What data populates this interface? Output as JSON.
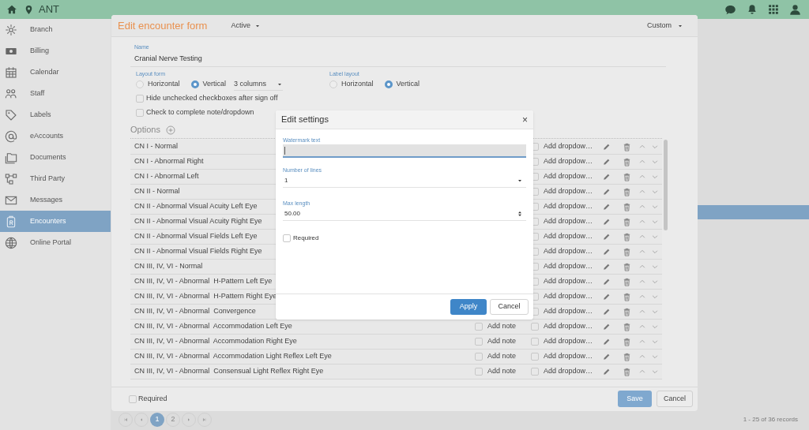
{
  "topbar": {
    "location": "ANT"
  },
  "sidebar": {
    "items": [
      {
        "label": "Branch",
        "selected": false
      },
      {
        "label": "Billing",
        "selected": false
      },
      {
        "label": "Calendar",
        "selected": false
      },
      {
        "label": "Staff",
        "selected": false
      },
      {
        "label": "Labels",
        "selected": false
      },
      {
        "label": "eAccounts",
        "selected": false
      },
      {
        "label": "Documents",
        "selected": false
      },
      {
        "label": "Third Party",
        "selected": false
      },
      {
        "label": "Messages",
        "selected": false
      },
      {
        "label": "Encounters",
        "selected": true
      },
      {
        "label": "Online Portal",
        "selected": false
      }
    ]
  },
  "pagination": {
    "pages": [
      {
        "label": "1",
        "selected": true
      },
      {
        "label": "2",
        "selected": false
      }
    ],
    "records": "1 - 25 of 36 records"
  },
  "form": {
    "title": "Edit encounter form",
    "status": "Active",
    "template": "Custom",
    "name_label": "Name",
    "name": "Cranial Nerve Testing",
    "layout_form": {
      "label": "Layout form",
      "options": [
        {
          "label": "Horizontal",
          "selected": false
        },
        {
          "label": "Vertical",
          "selected": true
        }
      ],
      "columns": "3 columns"
    },
    "label_layout": {
      "label": "Label layout",
      "options": [
        {
          "label": "Horizontal",
          "selected": false
        },
        {
          "label": "Vertical",
          "selected": true
        }
      ]
    },
    "checks": [
      {
        "label": "Hide unchecked checkboxes after sign off",
        "checked": false
      },
      {
        "label": "Check to complete note/dropdown",
        "checked": false
      }
    ],
    "options_title": "Options",
    "rows": [
      {
        "name": "CN I - Normal",
        "dropdown": "Add dropdow…",
        "dropdown_checked": false
      },
      {
        "name": "CN I - Abnormal Right",
        "dropdown": "Add dropdow…",
        "dropdown_checked": false
      },
      {
        "name": "CN I - Abnormal Left",
        "dropdown": "Add dropdow…",
        "dropdown_checked": false
      },
      {
        "name": "CN II - Normal",
        "dropdown": "Add dropdow…",
        "dropdown_checked": false
      },
      {
        "name": "CN II - Abnormal Visual Acuity Left Eye",
        "dropdown": "Add dropdow…",
        "dropdown_checked": false
      },
      {
        "name": "CN II - Abnormal Visual Acuity Right Eye",
        "dropdown": "Add dropdow…",
        "dropdown_checked": false
      },
      {
        "name": "CN II - Abnormal Visual Fields Left Eye",
        "dropdown": "Add dropdow…",
        "dropdown_checked": false
      },
      {
        "name": "CN II - Abnormal Visual Fields Right Eye",
        "dropdown": "Add dropdow…",
        "dropdown_checked": false
      },
      {
        "name": "CN III, IV, VI - Normal",
        "dropdown": "Add dropdow…",
        "dropdown_checked": false
      },
      {
        "name": "CN III, IV, VI - Abnormal  H-Pattern Left Eye",
        "dropdown": "Add dropdow…",
        "dropdown_checked": false
      },
      {
        "name": "CN III, IV, VI - Abnormal  H-Pattern Right Eye",
        "dropdown": "Add dropdow…",
        "dropdown_checked": false
      },
      {
        "name": "CN III, IV, VI - Abnormal  Convergence",
        "dropdown": "Add dropdow…",
        "dropdown_checked": false
      },
      {
        "name": "CN III, IV, VI - Abnormal  Accommodation Left Eye",
        "note": "Add note",
        "note_checked": false,
        "dropdown": "Add dropdow…",
        "dropdown_checked": false
      },
      {
        "name": "CN III, IV, VI - Abnormal  Accommodation Right Eye",
        "note": "Add note",
        "note_checked": false,
        "dropdown": "Add dropdow…",
        "dropdown_checked": false
      },
      {
        "name": "CN III, IV, VI - Abnormal  Accommodation Light Reflex Left Eye",
        "note": "Add note",
        "note_checked": false,
        "dropdown": "Add dropdow…",
        "dropdown_checked": false
      },
      {
        "name": "CN III, IV, VI - Abnormal  Consensual Light Reflex Right Eye",
        "note": "Add note",
        "note_checked": false,
        "dropdown": "Add dropdow…",
        "dropdown_checked": false
      }
    ],
    "required": {
      "label": "Required",
      "checked": false
    },
    "save": "Save",
    "cancel": "Cancel"
  },
  "settings": {
    "title": "Edit settings",
    "close": "×",
    "fields": [
      {
        "kind": "text",
        "label": "Watermark text",
        "focused": true
      },
      {
        "kind": "select",
        "label": "Number of lines",
        "value": "1",
        "focused": false
      },
      {
        "kind": "number",
        "label": "Max length",
        "value": "50.00",
        "focused": false
      }
    ],
    "required": {
      "label": "Required",
      "checked": false
    },
    "apply": "Apply",
    "cancel": "Cancel"
  }
}
